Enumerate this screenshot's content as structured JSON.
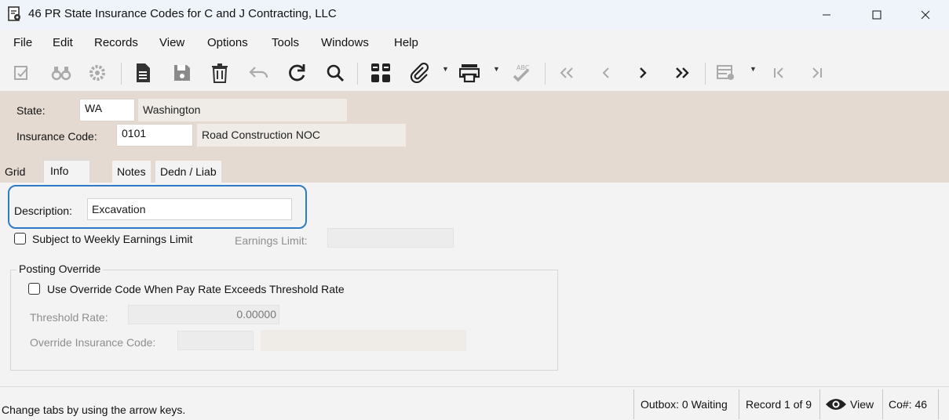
{
  "window": {
    "title": "46 PR State Insurance Codes for C and J Contracting, LLC",
    "app_icon": "document-gear-icon",
    "controls": [
      "minimize-icon",
      "maximize-icon",
      "close-icon"
    ]
  },
  "menu": {
    "items": [
      "File",
      "Edit",
      "Records",
      "View",
      "Options",
      "Tools",
      "Windows",
      "Help"
    ]
  },
  "toolbar": {
    "icons": [
      "checklist-icon",
      "binoculars-icon",
      "gear-settings-icon",
      "new-document-icon",
      "save-icon",
      "delete-trash-icon",
      "undo-icon",
      "refresh-icon",
      "search-icon",
      "grid-layout-icon",
      "attach-paperclip-icon",
      "print-icon",
      "spellcheck-icon",
      "first-record-icon",
      "previous-record-icon",
      "next-record-icon",
      "last-record-icon",
      "view-options-icon",
      "first-page-icon",
      "last-page-icon"
    ]
  },
  "header": {
    "state_label": "State:",
    "state_code": "WA",
    "state_name": "Washington",
    "insurance_code_label": "Insurance Code:",
    "insurance_code": "0101",
    "insurance_code_desc": "Road Construction NOC"
  },
  "tabs": [
    {
      "label": "Grid"
    },
    {
      "label": "Info"
    },
    {
      "label": "Notes"
    },
    {
      "label": "Dedn / Liab"
    }
  ],
  "info": {
    "description_label": "Description:",
    "description_value": "Excavation",
    "weekly_limit_label": "Subject to Weekly Earnings Limit",
    "weekly_limit_checked": false,
    "earnings_limit_label": "Earnings Limit:",
    "earnings_limit_value": "",
    "posting_override_legend": "Posting Override",
    "override_checkbox_label": "Use Override Code When Pay Rate Exceeds Threshold Rate",
    "override_checked": false,
    "threshold_rate_label": "Threshold Rate:",
    "threshold_rate_value": "0.00000",
    "override_code_label": "Override Insurance Code:",
    "override_code_value": "",
    "override_code_desc": ""
  },
  "status": {
    "message": "Change tabs by using the arrow keys.",
    "outbox": "Outbox: 0 Waiting",
    "record": "Record 1 of 9",
    "mode": "View",
    "mode_icon": "eye-icon",
    "company": "Co#: 46"
  },
  "colors": {
    "header_bg": "#e4dad1",
    "highlight": "#2f7ac4",
    "titlebar_bg": "#eef4f9"
  }
}
